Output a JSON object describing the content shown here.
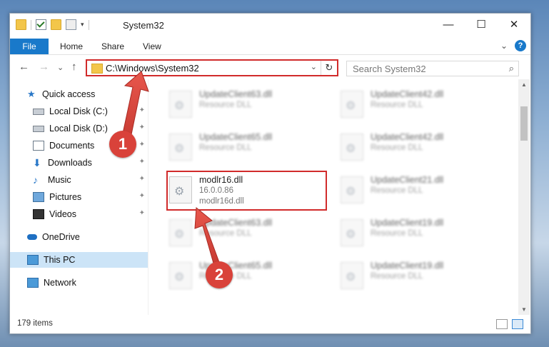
{
  "window": {
    "title": "System32",
    "controls": {
      "minimize": "—",
      "maximize": "☐",
      "close": "✕"
    }
  },
  "ribbon": {
    "tabs": [
      "File",
      "Home",
      "Share",
      "View"
    ],
    "collapse": "⌄",
    "help": "?"
  },
  "nav": {
    "back": "←",
    "forward": "→",
    "recent": "⌄",
    "up": "↑",
    "address": "C:\\Windows\\System32",
    "address_dropdown": "⌄",
    "refresh": "↻",
    "search_placeholder": "Search System32",
    "search_icon": "⌕"
  },
  "sidebar": {
    "items": [
      {
        "label": "Quick access",
        "icon": "star-icon",
        "pinned": false
      },
      {
        "label": "Local Disk (C:)",
        "icon": "disk-icon",
        "pinned": true
      },
      {
        "label": "Local Disk (D:)",
        "icon": "disk-icon",
        "pinned": true
      },
      {
        "label": "Documents",
        "icon": "document-icon",
        "pinned": true
      },
      {
        "label": "Downloads",
        "icon": "download-icon",
        "pinned": true
      },
      {
        "label": "Music",
        "icon": "music-icon",
        "pinned": true
      },
      {
        "label": "Pictures",
        "icon": "picture-icon",
        "pinned": true
      },
      {
        "label": "Videos",
        "icon": "video-icon",
        "pinned": true
      },
      {
        "label": "OneDrive",
        "icon": "cloud-icon",
        "pinned": false
      },
      {
        "label": "This PC",
        "icon": "computer-icon",
        "pinned": false,
        "selected": true
      },
      {
        "label": "Network",
        "icon": "network-icon",
        "pinned": false
      }
    ],
    "pin_glyph": "📌"
  },
  "files": {
    "left": [
      {
        "name": "UpdateClient63.dll",
        "type": "Resource DLL"
      },
      {
        "name": "UpdateClient65.dll",
        "type": "Resource DLL"
      },
      {
        "name": "modlr16.dll",
        "version": "16.0.0.86",
        "desc": "modlr16d.dll",
        "highlighted": true
      },
      {
        "name": "UpdateClient63.dll",
        "type": "Resource DLL"
      },
      {
        "name": "UpdateClient65.dll",
        "type": "Resource DLL"
      }
    ],
    "right": [
      {
        "name": "UpdateClient42.dll",
        "type": "Resource DLL"
      },
      {
        "name": "UpdateClient42.dll",
        "type": "Resource DLL"
      },
      {
        "name": "UpdateClient21.dll",
        "type": "Resource DLL"
      },
      {
        "name": "UpdateClient19.dll",
        "type": "Resource DLL"
      },
      {
        "name": "UpdateClient19.dll",
        "type": "Resource DLL"
      }
    ]
  },
  "status": {
    "count": "179 items"
  },
  "callouts": [
    "1",
    "2"
  ],
  "colors": {
    "accent": "#1979ca",
    "highlight": "#d12b2b",
    "callout": "#d9423a",
    "selected": "#cce4f7"
  }
}
